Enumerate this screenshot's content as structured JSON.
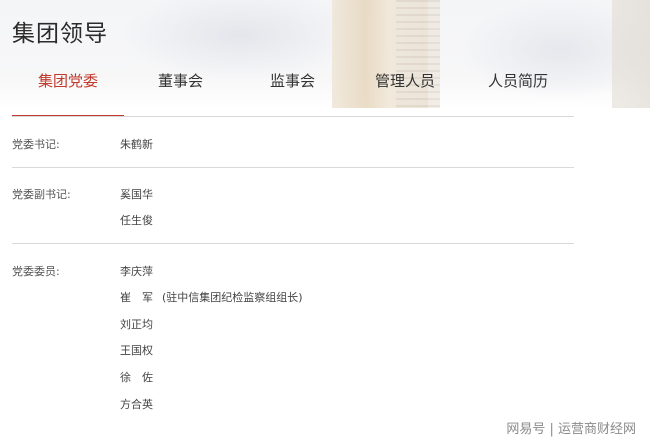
{
  "page": {
    "title": "集团领导"
  },
  "tabs": [
    {
      "label": "集团党委",
      "active": true
    },
    {
      "label": "董事会"
    },
    {
      "label": "监事会"
    },
    {
      "label": "管理人员"
    },
    {
      "label": "人员简历"
    }
  ],
  "sections": [
    {
      "label": "党委书记:",
      "names": [
        "朱鹤新"
      ]
    },
    {
      "label": "党委副书记:",
      "names": [
        "奚国华",
        "任生俊"
      ]
    },
    {
      "label": "党委委员:",
      "names": [
        "李庆萍",
        "崔　军",
        "刘正均",
        "王国权",
        "徐　佐",
        "方合英"
      ],
      "note": "(驻中信集团纪检监察组组长)"
    }
  ],
  "watermark": "网易号 | 运营商财经网",
  "colors": {
    "accent": "#c0392b",
    "divider": "#d9d9d9",
    "title": "#2b2b2b"
  }
}
